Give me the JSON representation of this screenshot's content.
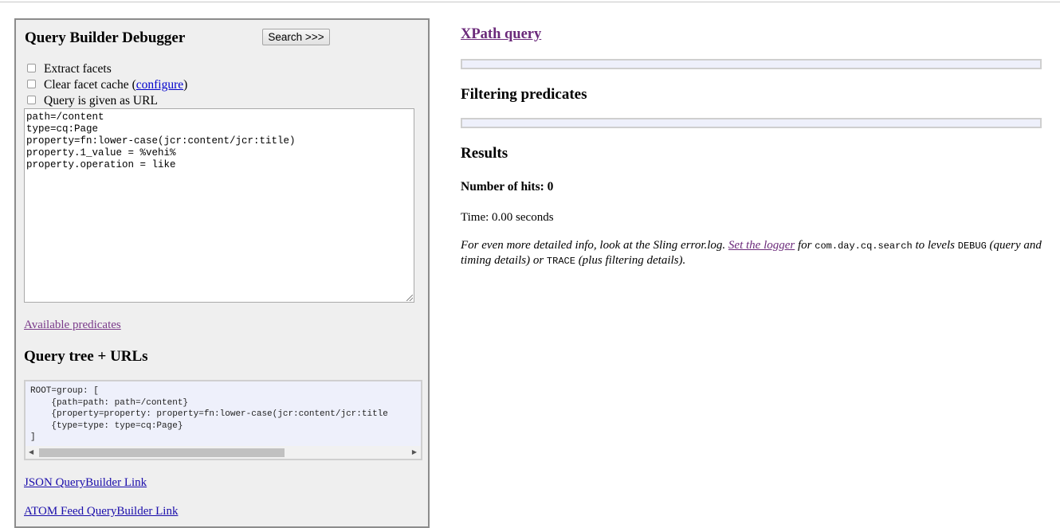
{
  "left": {
    "title": "Query Builder Debugger",
    "search_button": "Search >>>",
    "options": {
      "extract_facets": "Extract facets",
      "clear_cache_before": "Clear facet cache (",
      "clear_cache_link": "configure",
      "clear_cache_after": ")",
      "query_as_url": "Query is given as URL"
    },
    "query_text": "path=/content\ntype=cq:Page\nproperty=fn:lower-case(jcr:content/jcr:title)\nproperty.1_value = %vehi%\nproperty.operation = like",
    "available_predicates": "Available predicates",
    "query_tree_title": "Query tree + URLs",
    "query_tree": "ROOT=group: [\n    {path=path: path=/content}\n    {property=property: property=fn:lower-case(jcr:content/jcr:title\n    {type=type: type=cq:Page}\n]",
    "json_link": "JSON QueryBuilder Link",
    "atom_link": "ATOM Feed QueryBuilder Link"
  },
  "right": {
    "xpath_link": "XPath query",
    "filtering_title": "Filtering predicates",
    "results_title": "Results",
    "hits": "Number of hits: 0",
    "time": "Time: 0.00 seconds",
    "info": {
      "part1": "For even more detailed info, look at the Sling error.log. ",
      "logger_link": "Set the logger",
      "part2": " for ",
      "code1": "com.day.cq.search",
      "part3": " to levels ",
      "code2": "DEBUG",
      "part4": " (query and timing details) or ",
      "code3": "TRACE",
      "part5": " (plus filtering details)."
    }
  },
  "colors": {
    "link": "#1a0dab",
    "visited": "#6b2a7a",
    "panel_bg": "#efefef",
    "code_bg": "#eef0fb"
  }
}
